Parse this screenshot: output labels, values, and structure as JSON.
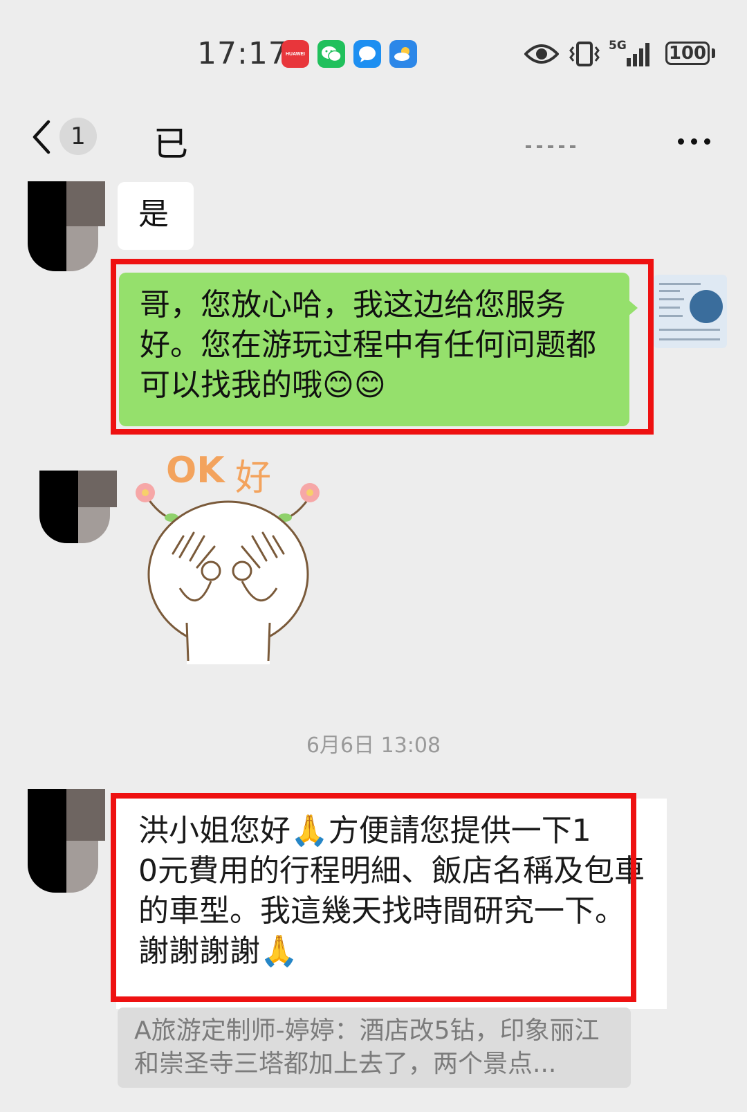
{
  "status_bar": {
    "time": "17:17",
    "huawei_label": "HUAWEI",
    "battery": "100",
    "network": "5G",
    "icons": [
      "huawei-appgallery-icon",
      "wechat-icon",
      "message-icon",
      "weather-icon",
      "eye-icon",
      "vibrate-icon",
      "signal-icon",
      "battery-icon"
    ]
  },
  "header": {
    "unread_count": "1",
    "title": "已"
  },
  "messages": [
    {
      "from": "other",
      "text": "是"
    },
    {
      "from": "self",
      "text": "哥，您放心哈，我这边给您服务好。您在游玩过程中有任何问题都可以找我的哦😊😊",
      "highlighted": true
    },
    {
      "from": "other",
      "type": "sticker",
      "sticker_text_1": "OK",
      "sticker_text_2": "好"
    }
  ],
  "timestamp": "6月6日 13:08",
  "message_4": {
    "from": "other",
    "text": "洪小姐您好🙏方便請您提供一下1　　0元費用的行程明細、飯店名稱及包車的車型。我這幾天找時間研究一下。謝謝謝謝🙏",
    "highlighted": true
  },
  "quote": {
    "text": "A旅游定制师-婷婷：酒店改5钻，印象丽江和崇圣寺三塔都加上去了，两个景点..."
  },
  "colors": {
    "background": "#ededed",
    "self_bubble": "#95e06c",
    "highlight": "#ee1111",
    "timestamp": "#9a9a9a"
  }
}
